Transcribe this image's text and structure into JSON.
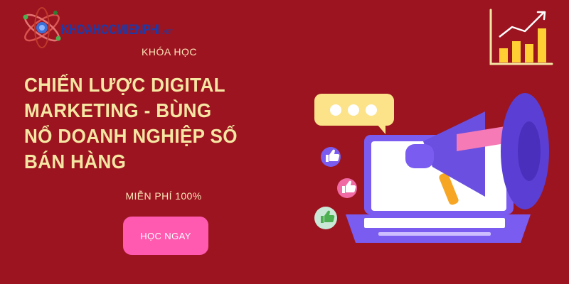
{
  "brand": {
    "logo_text": "KHOAHOCMIENPHI",
    "logo_suffix": ".NET"
  },
  "hero": {
    "kicker": "KHÓA HỌC",
    "title_lines": [
      "CHIẾN LƯỢC DIGITAL",
      "MARKETING - BÙNG",
      "NỔ DOANH NGHIỆP SỐ",
      "BÁN HÀNG"
    ],
    "subtitle": "MIỄN PHÍ 100%",
    "cta_label": "HỌC NGAY"
  },
  "colors": {
    "background": "#9b1420",
    "title": "#f6e6a3",
    "cta": "#ff59b0",
    "megaphone": "#6a4fe0",
    "laptop": "#7b5cf0",
    "chat_bubble": "#fce38a",
    "like_badges": [
      "#7b5cf0",
      "#f06ba4",
      "#c9e8d6"
    ]
  },
  "icons": [
    "atom-logo-icon",
    "growth-chart-icon",
    "megaphone-icon",
    "laptop-icon",
    "chat-bubble-icon",
    "thumbs-up-icon"
  ]
}
